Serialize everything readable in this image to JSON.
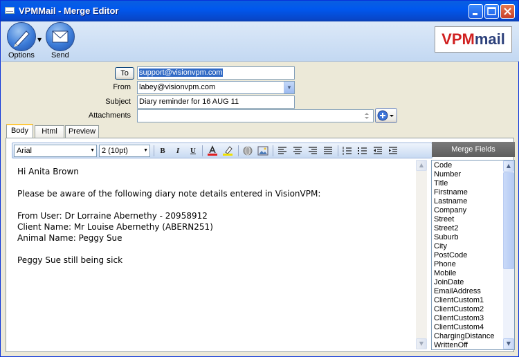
{
  "window": {
    "title": "VPMMail - Merge Editor"
  },
  "toolbar": {
    "options_label": "Options",
    "send_label": "Send"
  },
  "logo": {
    "part1": "VPM",
    "part2": "mail"
  },
  "form": {
    "to_button": "To",
    "to_value": "support@visionvpm.com",
    "from_label": "From",
    "from_value": "labey@visionvpm.com",
    "subject_label": "Subject",
    "subject_value": "Diary reminder for 16 AUG 11",
    "attachments_label": "Attachments",
    "attachments_value": ""
  },
  "tabs": [
    {
      "label": "Body"
    },
    {
      "label": "Html"
    },
    {
      "label": "Preview"
    }
  ],
  "format": {
    "font": "Arial",
    "size": "2 (10pt)"
  },
  "body_lines": [
    "Hi Anita Brown",
    "",
    "Please be aware of the following diary note details entered in VisionVPM:",
    "",
    "From User: Dr Lorraine Abernethy - 20958912",
    "Client Name: Mr Louise Abernethy (ABERN251)",
    "Animal Name: Peggy Sue",
    "",
    "Peggy Sue still being sick"
  ],
  "merge_fields": {
    "header": "Merge Fields",
    "items": [
      "Code",
      "Number",
      "Title",
      "Firstname",
      "Lastname",
      "Company",
      "Street",
      "Street2",
      "Suburb",
      "City",
      "PostCode",
      "Phone",
      "Mobile",
      "JoinDate",
      "EmailAddress",
      "ClientCustom1",
      "ClientCustom2",
      "ClientCustom3",
      "ClientCustom4",
      "ChargingDistance",
      "WrittenOff"
    ]
  },
  "icons": {
    "options": "pen-icon",
    "send": "envelope-icon",
    "bold": "B",
    "italic": "I",
    "underline": "U"
  }
}
